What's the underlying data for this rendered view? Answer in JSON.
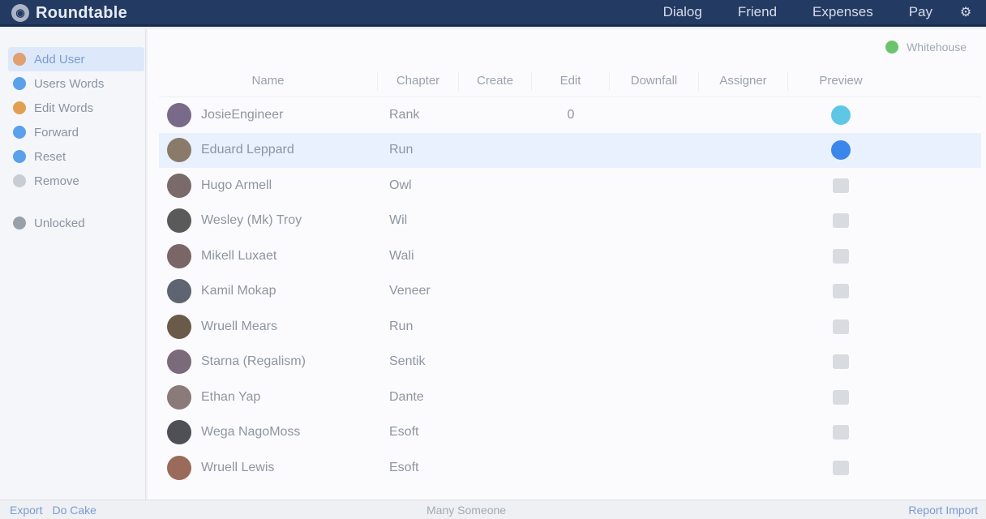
{
  "app": {
    "title": "Roundtable",
    "logo_icon": "app-logo-icon"
  },
  "topnav": {
    "items": [
      "Dialog",
      "Friend",
      "Expenses",
      "Pay"
    ],
    "settings_icon": "gear-icon"
  },
  "sidebar": {
    "items": [
      {
        "label": "Add User",
        "color": "#e0a070",
        "active": true
      },
      {
        "label": "Users Words",
        "color": "#5aa0ea",
        "active": false
      },
      {
        "label": "Edit Words",
        "color": "#e0a050",
        "active": false
      },
      {
        "label": "Forward",
        "color": "#5aa0ea",
        "active": false
      },
      {
        "label": "Reset",
        "color": "#5aa0ea",
        "active": false
      },
      {
        "label": "Remove",
        "color": "#c8ccd4",
        "active": false
      }
    ],
    "footer_item": {
      "label": "Unlocked",
      "color": "#9aa0aa"
    }
  },
  "main": {
    "online_label": "Whitehouse",
    "online_color": "#6bc46d",
    "columns": [
      "Name",
      "Chapter",
      "Create",
      "Edit",
      "Downfall",
      "Assigner",
      "Preview"
    ],
    "rows": [
      {
        "name": "JosieEngineer",
        "group": "Rank",
        "edit": "0",
        "status": "cyan",
        "avatar": "#7a6a8a",
        "selected": false
      },
      {
        "name": "Eduard Leppard",
        "group": "Run",
        "edit": "",
        "status": "blue",
        "avatar": "#8a7a6a",
        "selected": true
      },
      {
        "name": "Hugo Armell",
        "group": "Owl",
        "edit": "",
        "status": "grey",
        "avatar": "#7a6a6a",
        "selected": false
      },
      {
        "name": "Wesley (Mk) Troy",
        "group": "Wil",
        "edit": "",
        "status": "grey",
        "avatar": "#5a5a5a",
        "selected": false
      },
      {
        "name": "Mikell Luxaet",
        "group": "Wali",
        "edit": "",
        "status": "grey",
        "avatar": "#7a6666",
        "selected": false
      },
      {
        "name": "Kamil Mokap",
        "group": "Veneer",
        "edit": "",
        "status": "grey",
        "avatar": "#5e6470",
        "selected": false
      },
      {
        "name": "Wruell Mears",
        "group": "Run",
        "edit": "",
        "status": "grey",
        "avatar": "#6a5a4a",
        "selected": false
      },
      {
        "name": "Starna (Regalism)",
        "group": "Sentik",
        "edit": "",
        "status": "grey",
        "avatar": "#7a6a7a",
        "selected": false
      },
      {
        "name": "Ethan Yap",
        "group": "Dante",
        "edit": "",
        "status": "grey",
        "avatar": "#8a7a7a",
        "selected": false
      },
      {
        "name": "Wega NagoMoss",
        "group": "Esoft",
        "edit": "",
        "status": "grey",
        "avatar": "#4e5056",
        "selected": false
      },
      {
        "name": "Wruell Lewis",
        "group": "Esoft",
        "edit": "",
        "status": "grey",
        "avatar": "#9a6a5a",
        "selected": false
      }
    ]
  },
  "bottombar": {
    "left_links": [
      "Export",
      "Do Cake"
    ],
    "center": "Many Someone",
    "right_link": "Report Import"
  }
}
